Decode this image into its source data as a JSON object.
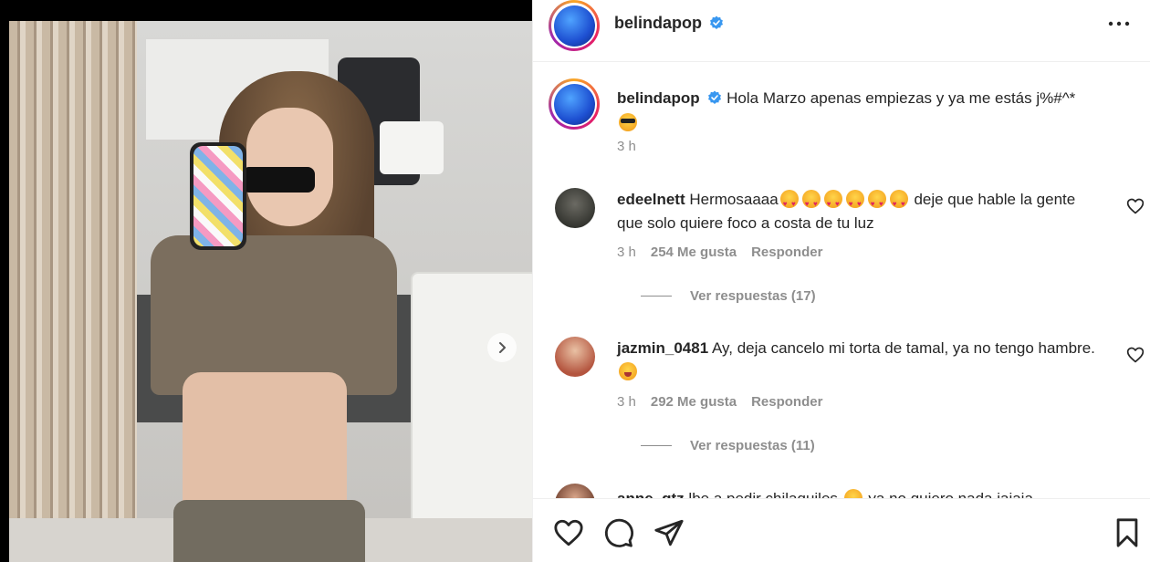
{
  "post": {
    "username": "belindapop",
    "verified": true,
    "caption": "Hola Marzo apenas empiezas y ya me estás j%#^*",
    "caption_emoji": "smiling-face-with-sunglasses",
    "time": "3 h"
  },
  "comments": [
    {
      "username": "edeelnett",
      "text_before": "Hermosaaaa",
      "emojis": [
        "heart-eyes",
        "heart-eyes",
        "heart-eyes",
        "heart-eyes",
        "heart-eyes",
        "heart-eyes"
      ],
      "text_after": "deje que hable la gente que solo quiere foco a costa de tu luz",
      "time": "3 h",
      "likes": "254 Me gusta",
      "reply": "Responder",
      "view_replies": "Ver respuestas (17)"
    },
    {
      "username": "jazmin_0481",
      "text_before": "Ay, deja cancelo mi torta de tamal, ya no tengo hambre.",
      "emojis": [
        "drooling-face"
      ],
      "text_after": "",
      "time": "3 h",
      "likes": "292 Me gusta",
      "reply": "Responder",
      "view_replies": "Ver respuestas (11)"
    },
    {
      "username": "anne_gtz",
      "text_before": "lbe a pedir chilaquiles",
      "emojis": [
        "face"
      ],
      "text_after": "ya no quiero nada jajaja",
      "partial": true
    }
  ],
  "icons": {
    "more": "more-options-icon",
    "like": "heart-icon",
    "comment": "comment-bubble-icon",
    "share": "paper-plane-icon",
    "save": "bookmark-icon",
    "next": "chevron-right-icon",
    "verified": "verified-badge-icon"
  },
  "colors": {
    "text": "#262626",
    "muted": "#8e8e8e",
    "verified": "#3897f0",
    "border": "#efefef"
  }
}
